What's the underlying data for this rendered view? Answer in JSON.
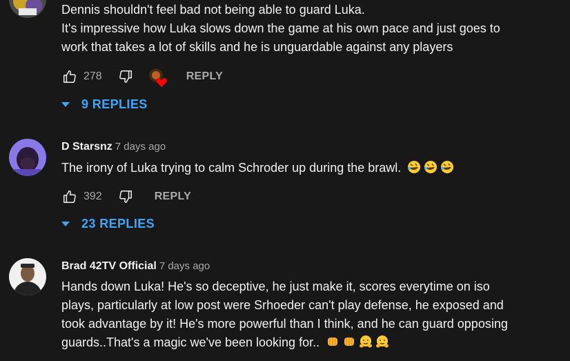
{
  "comments": [
    {
      "author": "",
      "date": "",
      "lines": [
        "Dennis shouldn't feel bad not being able to guard Luka.",
        "It's impressive how Luka slows down the game at his own pace and just goes to",
        "work that takes a lot of skills and he is unguardable against any players"
      ],
      "likes": "278",
      "reply_label": "REPLY",
      "replies_label": "9 REPLIES",
      "avatar_color": "#5a4a2a"
    },
    {
      "author": "D Starsnz",
      "date": "7 days ago",
      "lines": [
        "The irony of Luka trying to calm Schroder up during the brawl."
      ],
      "emojis": [
        "rolling-on-floor-laughing-emoji",
        "rolling-on-floor-laughing-emoji",
        "rolling-on-floor-laughing-emoji"
      ],
      "likes": "392",
      "reply_label": "REPLY",
      "replies_label": "23 REPLIES",
      "avatar_color": "#7a6ad8"
    },
    {
      "author": "Brad 42TV Official",
      "date": "7 days ago",
      "lines": [
        "Hands down Luka! He's so deceptive, he just make it, scores everytime on iso",
        "plays, particularly at low post were Srhoeder can't play defense, he exposed and",
        "took advantage by it! He's more powerful than I think, and he can guard opposing",
        "guards..That's a magic we've been looking for.."
      ],
      "emojis": [
        "oncoming-fist-emoji",
        "oncoming-fist-emoji",
        "hugging-face-emoji",
        "hugging-face-emoji"
      ],
      "avatar_color": "#e8e8e8"
    }
  ],
  "colors": {
    "background": "#181818",
    "text": "#f1f1f1",
    "muted": "#aaaaaa",
    "link": "#3ea6ff",
    "heart": "#ff0000"
  }
}
